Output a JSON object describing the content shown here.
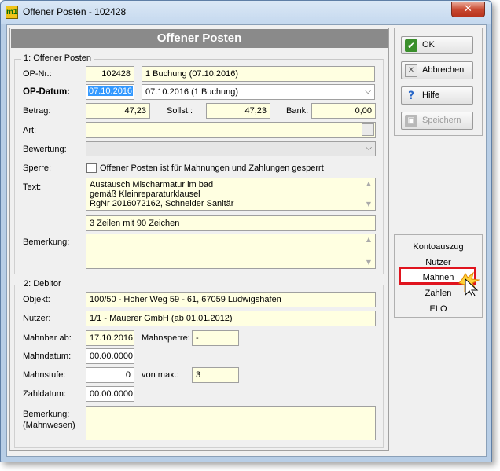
{
  "window": {
    "title": "Offener Posten - 102428",
    "app_icon_text": "m1",
    "close_symbol": "✕"
  },
  "header": {
    "title": "Offener Posten"
  },
  "section1": {
    "title": "1: Offener Posten",
    "op_nr": {
      "label": "OP-Nr.:",
      "value": "102428",
      "info": "1 Buchung (07.10.2016)"
    },
    "op_datum": {
      "label": "OP-Datum:",
      "value": "07.10.2016",
      "dropdown": "07.10.2016 (1 Buchung)"
    },
    "betrag": {
      "label": "Betrag:",
      "value": "47,23"
    },
    "sollst": {
      "label": "Sollst.:",
      "value": "47,23"
    },
    "bank": {
      "label": "Bank:",
      "value": "0,00"
    },
    "art": {
      "label": "Art:",
      "value": "",
      "button": "..."
    },
    "bewertung": {
      "label": "Bewertung:",
      "value": ""
    },
    "sperre": {
      "label": "Sperre:",
      "checkbox_label": "Offener Posten ist für Mahnungen und Zahlungen gesperrt",
      "checked": false
    },
    "text": {
      "label": "Text:",
      "lines": [
        "Austausch Mischarmatur im bad",
        "gemäß Kleinreparaturklausel",
        "RgNr 2016072162, Schneider Sanitär"
      ],
      "info": "3 Zeilen mit 90 Zeichen"
    },
    "bemerkung": {
      "label": "Bemerkung:",
      "value": ""
    }
  },
  "section2": {
    "title": "2: Debitor",
    "objekt": {
      "label": "Objekt:",
      "value": "100/50 - Hoher Weg 59 - 61, 67059 Ludwigshafen"
    },
    "nutzer": {
      "label": "Nutzer:",
      "value": "1/1 - Mauerer GmbH (ab 01.01.2012)"
    },
    "mahnbar_ab": {
      "label": "Mahnbar ab:",
      "value": "17.10.2016"
    },
    "mahnsperre": {
      "label": "Mahnsperre:",
      "value": "-"
    },
    "mahndatum": {
      "label": "Mahndatum:",
      "value": "00.00.0000"
    },
    "mahnstufe": {
      "label": "Mahnstufe:",
      "value": "0"
    },
    "von_max": {
      "label": "von max.:",
      "value": "3"
    },
    "zahldatum": {
      "label": "Zahldatum:",
      "value": "00.00.0000"
    },
    "bemerkung": {
      "label1": "Bemerkung:",
      "label2": "(Mahnwesen)",
      "value": ""
    }
  },
  "buttons": {
    "ok": {
      "label": "OK",
      "icon": "check-icon",
      "glyph": "✔"
    },
    "abbrechen": {
      "label": "Abbrechen",
      "icon": "cancel-icon",
      "glyph": "✕"
    },
    "hilfe": {
      "label": "Hilfe",
      "icon": "help-icon",
      "glyph": "?"
    },
    "speichern": {
      "label": "Speichern",
      "icon": "save-icon",
      "glyph": "▣",
      "enabled": false
    }
  },
  "nav": {
    "items": [
      "Kontoauszug",
      "Nutzer",
      "Mahnen",
      "Zahlen",
      "ELO"
    ],
    "highlighted": "Mahnen",
    "highlight_color": "#e0141e"
  },
  "colors": {
    "header_bg": "#8a8a8a",
    "field_bg": "#ffffe1",
    "selection": "#3399ff"
  }
}
